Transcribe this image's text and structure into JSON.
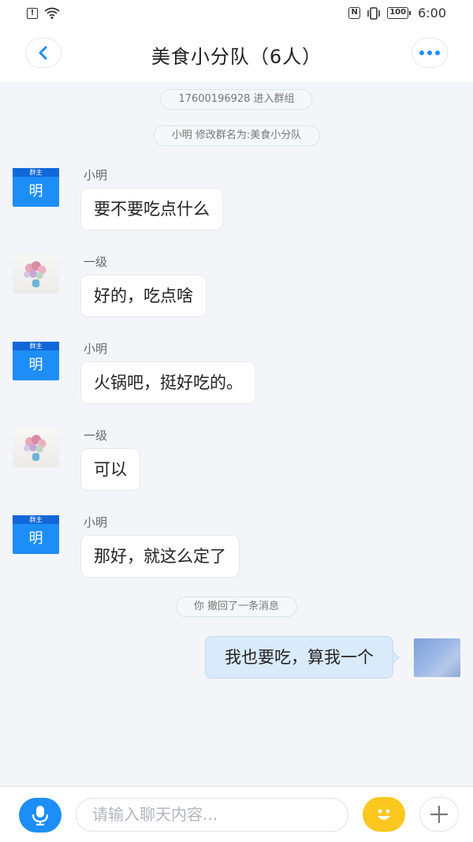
{
  "status_bar": {
    "time": "6:00",
    "battery": "100",
    "nfc": "N",
    "alert": "!"
  },
  "header": {
    "title": "美食小分队（6人）"
  },
  "notices": [
    "17600196928 进入群组",
    "小明 修改群名为:美食小分队",
    "你 撤回了一条消息"
  ],
  "messages": [
    {
      "sender": "小明",
      "text": "要不要吃点什么",
      "avatar_badge": "群主",
      "avatar_text": "明"
    },
    {
      "sender": "一级",
      "text": "好的，吃点啥"
    },
    {
      "sender": "小明",
      "text": "火锅吧，挺好吃的。",
      "avatar_badge": "群主",
      "avatar_text": "明"
    },
    {
      "sender": "一级",
      "text": "可以"
    },
    {
      "sender": "小明",
      "text": "那好，就这么定了",
      "avatar_badge": "群主",
      "avatar_text": "明"
    }
  ],
  "self_message": {
    "text": "我也要吃，算我一个"
  },
  "input": {
    "placeholder": "请输入聊天内容..."
  },
  "colors": {
    "accent": "#1d8ef7",
    "self_bubble": "#d9eafb",
    "emoji": "#f9c71e",
    "background": "#f3f5f9"
  },
  "icons": [
    "alert-icon",
    "wifi-icon",
    "nfc-icon",
    "vibrate-icon",
    "battery-icon",
    "back-icon",
    "more-icon",
    "mic-icon",
    "emoji-icon",
    "plus-icon"
  ]
}
